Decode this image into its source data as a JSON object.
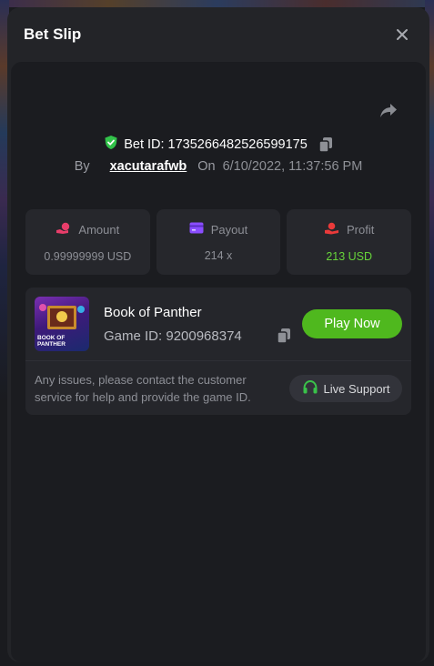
{
  "modal": {
    "title": "Bet Slip",
    "close_icon": "close-icon"
  },
  "bet": {
    "id_label": "Bet ID:",
    "id_value": "1735266482526599175",
    "by_label": "By",
    "username": "xacutarafwb",
    "on_label": "On",
    "date": "6/10/2022, 11:37:56 PM"
  },
  "stats": {
    "amount": {
      "label": "Amount",
      "value": "0.99999999 USD",
      "icon": "amount-icon"
    },
    "payout": {
      "label": "Payout",
      "value": "214 x",
      "icon": "payout-icon"
    },
    "profit": {
      "label": "Profit",
      "value": "213 USD",
      "icon": "profit-icon"
    }
  },
  "game": {
    "name": "Book of Panther",
    "id_text": "Game ID: 9200968374",
    "thumb_text_line1": "BOOK OF",
    "thumb_text_line2": "PANTHER",
    "play_label": "Play Now"
  },
  "support": {
    "notice": "Any issues, please contact the customer service for help and provide the game ID.",
    "button_label": "Live Support"
  },
  "colors": {
    "accent_green": "#4fb81e",
    "profit_green": "#67d53a",
    "amount_pink": "#e83d6a",
    "payout_purple": "#8a4dff",
    "profit_red": "#ea3a3a"
  }
}
